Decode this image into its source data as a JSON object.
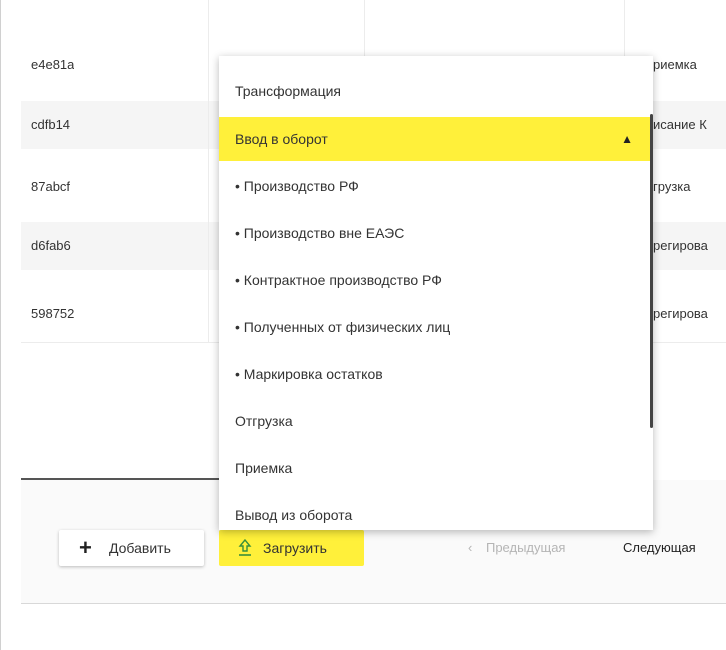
{
  "table": {
    "rows": [
      {
        "id": "e4e81a",
        "type": "риемка"
      },
      {
        "id": "cdfb14",
        "type": "исание К"
      },
      {
        "id": "87abcf",
        "type": "грузка"
      },
      {
        "id": "d6fab6",
        "type": "регирова"
      },
      {
        "id": "598752",
        "type": "регирова"
      }
    ]
  },
  "dropdown": {
    "items": [
      {
        "label": "Трансформация"
      },
      {
        "label": "Ввод в оборот",
        "expanded": true
      },
      {
        "label": "• Производство РФ"
      },
      {
        "label": "• Производство вне ЕАЭС"
      },
      {
        "label": "• Контрактное производство РФ"
      },
      {
        "label": "• Полученных от физических лиц"
      },
      {
        "label": "• Маркировка остатков"
      },
      {
        "label": "Отгрузка"
      },
      {
        "label": "Приемка"
      },
      {
        "label": "Вывод из оборота"
      }
    ],
    "chevron": "chevron-up-icon"
  },
  "footer": {
    "add_label": "Добавить",
    "upload_label": "Загрузить",
    "prev_label": "Предыдущая",
    "next_label": "Следующая"
  },
  "colors": {
    "accent": "#fff03a",
    "row_shade": "#f5f5f5"
  }
}
